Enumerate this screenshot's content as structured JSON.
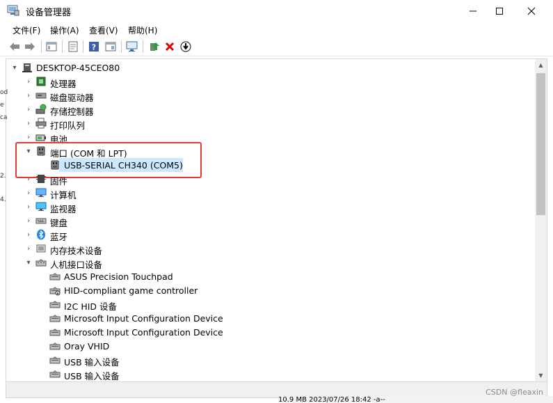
{
  "window": {
    "title": "设备管理器",
    "minimize_label": "─",
    "maximize_label": "☐",
    "close_label": "✕"
  },
  "menu": [
    {
      "label": "文件(F)"
    },
    {
      "label": "操作(A)"
    },
    {
      "label": "查看(V)"
    },
    {
      "label": "帮助(H)"
    }
  ],
  "tree": {
    "root": "DESKTOP-45CEO80",
    "categories": [
      {
        "label": "处理器",
        "icon": "processor-icon",
        "expanded": false
      },
      {
        "label": "磁盘驱动器",
        "icon": "disk-drive-icon",
        "expanded": false
      },
      {
        "label": "存储控制器",
        "icon": "storage-controller-icon",
        "expanded": false
      },
      {
        "label": "打印队列",
        "icon": "printer-icon",
        "expanded": false
      },
      {
        "label": "电池",
        "icon": "battery-icon",
        "expanded": false
      },
      {
        "label": "端口 (COM 和 LPT)",
        "icon": "port-icon",
        "expanded": true
      },
      {
        "label": "固件",
        "icon": "firmware-icon",
        "expanded": false
      },
      {
        "label": "计算机",
        "icon": "computer-icon",
        "expanded": false
      },
      {
        "label": "监视器",
        "icon": "monitor-icon",
        "expanded": false
      },
      {
        "label": "键盘",
        "icon": "keyboard-icon",
        "expanded": false
      },
      {
        "label": "蓝牙",
        "icon": "bluetooth-icon",
        "expanded": false
      },
      {
        "label": "内存技术设备",
        "icon": "memory-device-icon",
        "expanded": false
      },
      {
        "label": "人机接口设备",
        "icon": "hid-icon",
        "expanded": true
      }
    ],
    "port_children": [
      {
        "label": "USB-SERIAL CH340 (COM5)",
        "selected": true
      }
    ],
    "hid_children": [
      {
        "label": "ASUS Precision Touchpad"
      },
      {
        "label": "HID-compliant game controller"
      },
      {
        "label": "I2C HID 设备"
      },
      {
        "label": "Microsoft Input Configuration Device"
      },
      {
        "label": "Microsoft Input Configuration Device"
      },
      {
        "label": "Oray VHID"
      },
      {
        "label": "USB 输入设备"
      },
      {
        "label": "USB 输入设备"
      }
    ]
  },
  "background_text": "10.9 MB  2023/07/26 18:42  -a--",
  "left_fragments": [
    "od",
    "e",
    "ca",
    "2.",
    "4."
  ],
  "watermark": "CSDN @fleaxin",
  "colors": {
    "selection": "#cce8ff",
    "highlight_box": "#e53935",
    "bluetooth": "#1e88e5",
    "delete_red": "#e00000"
  }
}
